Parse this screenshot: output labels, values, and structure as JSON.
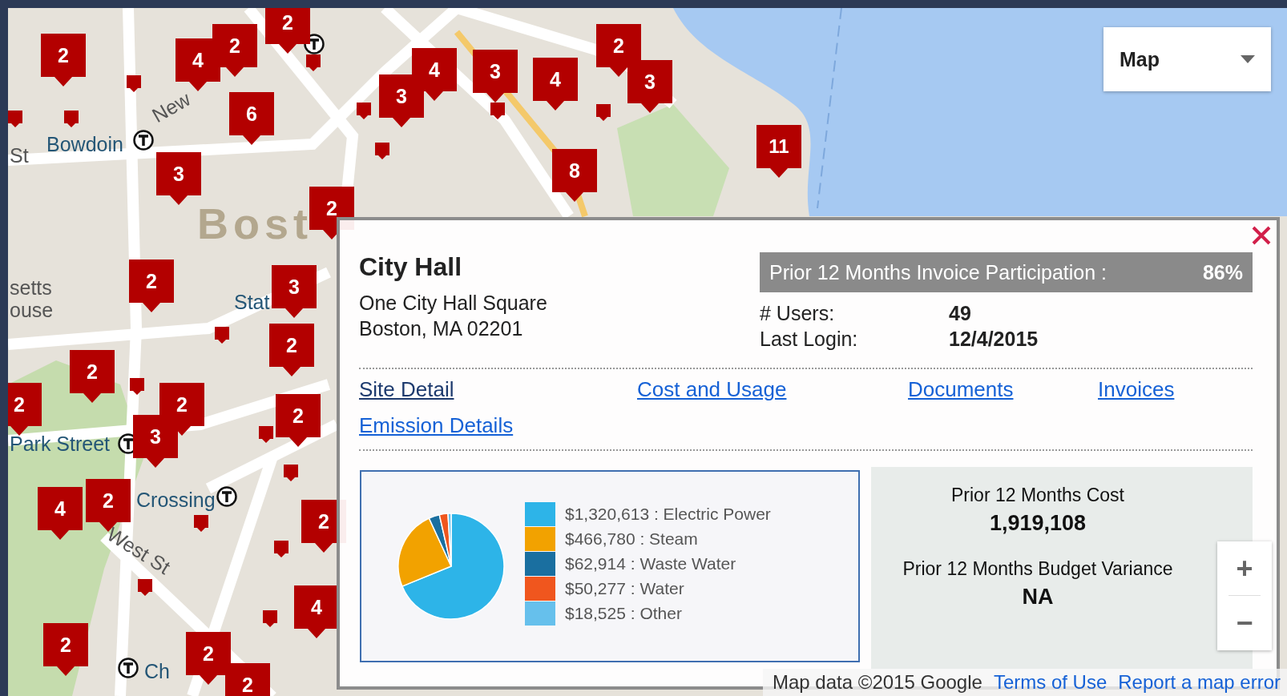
{
  "map_type": {
    "label": "Map"
  },
  "map_labels": [
    {
      "text": "Bowdoin",
      "kind": "station"
    },
    {
      "text": "Bost",
      "kind": "city"
    },
    {
      "text": "Stat",
      "kind": "station"
    },
    {
      "text": "Park Street",
      "kind": "station"
    },
    {
      "text": "Crossing",
      "kind": "station"
    },
    {
      "text": "West St",
      "kind": "street"
    },
    {
      "text": "New",
      "kind": "street"
    },
    {
      "text": "St",
      "kind": "street"
    },
    {
      "text": "setts",
      "kind": "street"
    },
    {
      "text": "ouse",
      "kind": "street"
    },
    {
      "text": "Ch",
      "kind": "station"
    }
  ],
  "clusters": [
    {
      "count": "2"
    },
    {
      "count": "4"
    },
    {
      "count": "2"
    },
    {
      "count": "2"
    },
    {
      "count": "6"
    },
    {
      "count": "3"
    },
    {
      "count": "3"
    },
    {
      "count": "4"
    },
    {
      "count": "3"
    },
    {
      "count": "4"
    },
    {
      "count": "2"
    },
    {
      "count": "3"
    },
    {
      "count": "11"
    },
    {
      "count": "8"
    },
    {
      "count": "2"
    },
    {
      "count": "2"
    },
    {
      "count": "3"
    },
    {
      "count": "2"
    },
    {
      "count": "2"
    },
    {
      "count": "2"
    },
    {
      "count": "2"
    },
    {
      "count": "3"
    },
    {
      "count": "2"
    },
    {
      "count": "4"
    },
    {
      "count": "2"
    },
    {
      "count": "2"
    },
    {
      "count": "4"
    },
    {
      "count": "2"
    },
    {
      "count": "2"
    },
    {
      "count": "2"
    }
  ],
  "popup": {
    "title": "City Hall",
    "address": [
      "One City Hall Square",
      "Boston, MA 02201"
    ],
    "participation": {
      "label": "Prior 12 Months Invoice Participation :",
      "value": "86%"
    },
    "stats": [
      {
        "label": "# Users:",
        "value": "49"
      },
      {
        "label": "Last Login:",
        "value": "12/4/2015"
      }
    ],
    "links": [
      {
        "label": "Site Detail",
        "visited": true
      },
      {
        "label": "Cost and Usage",
        "visited": false
      },
      {
        "label": "Documents",
        "visited": false
      },
      {
        "label": "Invoices",
        "visited": false
      },
      {
        "label": "Emission Details",
        "visited": false
      }
    ],
    "legend": [
      {
        "label": "$1,320,613 : Electric Power",
        "color": "#2db4e8"
      },
      {
        "label": "$466,780 : Steam",
        "color": "#f2a200"
      },
      {
        "label": "$62,914 : Waste Water",
        "color": "#1a6fa0"
      },
      {
        "label": "$50,277 : Water",
        "color": "#f0561e"
      },
      {
        "label": "$18,525 : Other",
        "color": "#66c0ec"
      }
    ],
    "chart_data": {
      "type": "pie",
      "values": [
        68.81,
        24.32,
        3.28,
        2.62,
        0.97
      ]
    },
    "summary": [
      {
        "label": "Prior 12 Months Cost",
        "value": "1,919,108"
      },
      {
        "label": "Prior 12 Months Budget Variance",
        "value": "NA"
      }
    ]
  },
  "zoom": {
    "in": "+",
    "out": "−"
  },
  "attribution": {
    "text": "Map data ©2015 Google",
    "links": [
      "Terms of Use",
      "Report a map error"
    ]
  }
}
